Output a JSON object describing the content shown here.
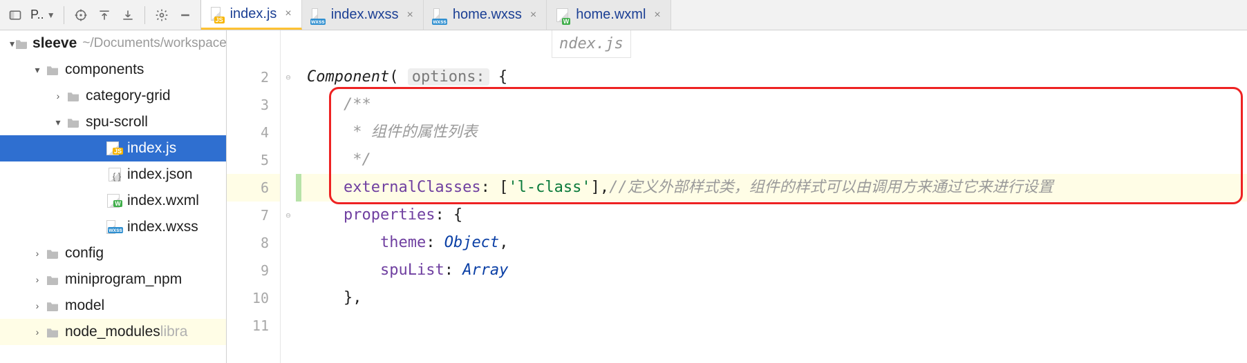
{
  "toolbar": {
    "project_label": "P..",
    "buttons": [
      "target-icon",
      "align-top-icon",
      "align-bottom-icon",
      "divider",
      "gear-icon",
      "collapse-icon"
    ]
  },
  "tabs": [
    {
      "name": "index.js",
      "icon": "js",
      "active": true
    },
    {
      "name": "index.wxss",
      "icon": "wxss",
      "active": false
    },
    {
      "name": "home.wxss",
      "icon": "wxss",
      "active": false
    },
    {
      "name": "home.wxml",
      "icon": "wxml",
      "active": false
    }
  ],
  "project_tree": {
    "root": {
      "name": "sleeve",
      "path": "~/Documents/workspace/java_full_stack/studycode/sleeve"
    },
    "nodes": [
      {
        "depth": 2,
        "kind": "folder",
        "expanded": true,
        "name": "components"
      },
      {
        "depth": 3,
        "kind": "folder",
        "expanded": false,
        "name": "category-grid"
      },
      {
        "depth": 3,
        "kind": "folder",
        "expanded": true,
        "name": "spu-scroll"
      },
      {
        "depth": 5,
        "kind": "file-js",
        "name": "index.js",
        "selected": true
      },
      {
        "depth": 5,
        "kind": "file-json",
        "name": "index.json"
      },
      {
        "depth": 5,
        "kind": "file-wxml",
        "name": "index.wxml"
      },
      {
        "depth": 5,
        "kind": "file-wxss",
        "name": "index.wxss"
      },
      {
        "depth": 2,
        "kind": "folder",
        "expanded": false,
        "name": "config"
      },
      {
        "depth": 2,
        "kind": "folder",
        "expanded": false,
        "name": "miniprogram_npm"
      },
      {
        "depth": 2,
        "kind": "folder",
        "expanded": false,
        "name": "model"
      },
      {
        "depth": 2,
        "kind": "folder",
        "expanded": false,
        "name": "node_modules",
        "suffix": "libra"
      }
    ]
  },
  "editor": {
    "breadcrumb_overlay": "ndex.js",
    "lines": {
      "2": {
        "indent": "",
        "tokens": [
          {
            "t": "ident",
            "v": "Component"
          },
          {
            "t": "plain",
            "v": "( "
          },
          {
            "t": "param",
            "v": "options:"
          },
          {
            "t": "plain",
            "v": " {"
          }
        ]
      },
      "3": {
        "indent": "    ",
        "tokens": [
          {
            "t": "comment",
            "v": "/**"
          }
        ]
      },
      "4": {
        "indent": "    ",
        "tokens": [
          {
            "t": "comment",
            "v": " * 组件的属性列表"
          }
        ]
      },
      "5": {
        "indent": "    ",
        "tokens": [
          {
            "t": "comment",
            "v": " */"
          }
        ]
      },
      "6": {
        "indent": "    ",
        "tokens": [
          {
            "t": "prop",
            "v": "externalClasses"
          },
          {
            "t": "plain",
            "v": ": ["
          },
          {
            "t": "str",
            "v": "'l-class'"
          },
          {
            "t": "plain",
            "v": "],"
          },
          {
            "t": "comment",
            "v": "//定义外部样式类，组件的样式可以由调用方来通过它来进行设置"
          }
        ]
      },
      "7": {
        "indent": "    ",
        "tokens": [
          {
            "t": "prop",
            "v": "properties"
          },
          {
            "t": "plain",
            "v": ": {"
          }
        ]
      },
      "8": {
        "indent": "        ",
        "tokens": [
          {
            "t": "prop",
            "v": "theme"
          },
          {
            "t": "plain",
            "v": ": "
          },
          {
            "t": "type",
            "v": "Object"
          },
          {
            "t": "plain",
            "v": ","
          }
        ]
      },
      "9": {
        "indent": "        ",
        "tokens": [
          {
            "t": "prop",
            "v": "spuList"
          },
          {
            "t": "plain",
            "v": ": "
          },
          {
            "t": "type",
            "v": "Array"
          }
        ]
      },
      "10": {
        "indent": "    ",
        "tokens": [
          {
            "t": "plain",
            "v": "},"
          }
        ]
      },
      "11": {
        "indent": "",
        "tokens": []
      }
    },
    "visible_line_start": 2,
    "visible_line_end": 11,
    "highlighted_line": 6,
    "change_marker_line": 6,
    "redbox_lines": [
      3,
      6
    ]
  }
}
